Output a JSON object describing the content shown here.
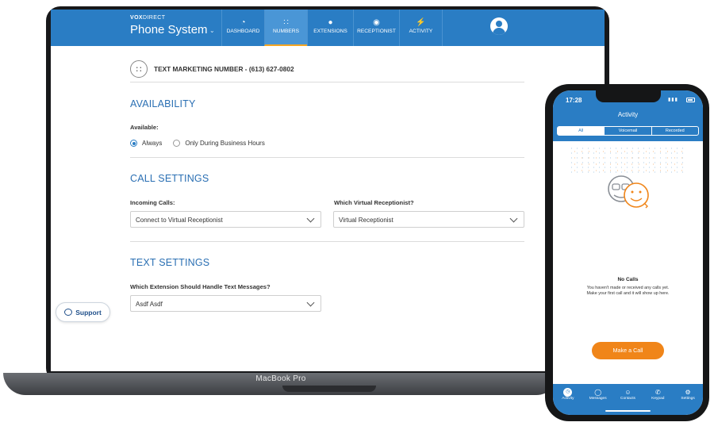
{
  "laptop": {
    "model_label": "MacBook Pro",
    "brand": {
      "prefix": "VOX",
      "suffix": "DIRECT",
      "product": "Phone System"
    },
    "nav": [
      {
        "label": "DASHBOARD",
        "icon": "gauge-icon"
      },
      {
        "label": "NUMBERS",
        "icon": "keypad-icon",
        "active": true
      },
      {
        "label": "EXTENSIONS",
        "icon": "person-icon"
      },
      {
        "label": "RECEPTIONIST",
        "icon": "headset-icon"
      },
      {
        "label": "ACTIVITY",
        "icon": "bolt-icon"
      }
    ],
    "number_title": "TEXT MARKETING NUMBER - (613) 627-0802",
    "availability": {
      "heading": "AVAILABILITY",
      "label": "Available:",
      "options": [
        "Always",
        "Only During Business Hours"
      ],
      "selected": "Always"
    },
    "call_settings": {
      "heading": "CALL SETTINGS",
      "incoming_label": "Incoming Calls:",
      "incoming_value": "Connect to Virtual Receptionist",
      "receptionist_label": "Which Virtual Receptionist?",
      "receptionist_value": "Virtual Receptionist"
    },
    "text_settings": {
      "heading": "TEXT SETTINGS",
      "extension_label": "Which Extension Should Handle Text Messages?",
      "extension_value": "Asdf Asdf"
    },
    "support_label": "Support"
  },
  "phone": {
    "time": "17:28",
    "title": "Activity",
    "tabs": [
      "All",
      "Voicemail",
      "Recorded"
    ],
    "active_tab": "All",
    "empty_title": "No Calls",
    "empty_desc": "You haven't made or received any calls yet. Make your first call and it will show up here.",
    "cta": "Make a Call",
    "tabbar": [
      {
        "label": "Activity",
        "icon": "clock-icon"
      },
      {
        "label": "Messages",
        "icon": "chat-icon"
      },
      {
        "label": "Contacts",
        "icon": "contacts-icon"
      },
      {
        "label": "Keypad",
        "icon": "handset-icon"
      },
      {
        "label": "Settings",
        "icon": "gear-icon"
      }
    ]
  },
  "colors": {
    "brand_blue": "#2a7dc4",
    "accent_orange": "#f08519",
    "heading_blue": "#2a6fb3"
  }
}
